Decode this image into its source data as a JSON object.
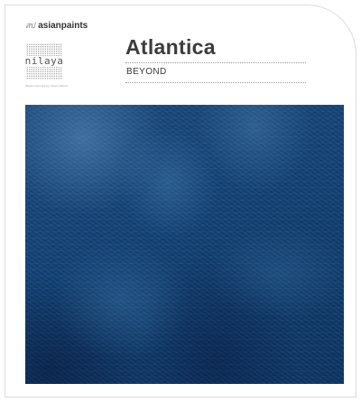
{
  "brand": {
    "mark": "สป",
    "name": "asianpaints"
  },
  "nilaya": {
    "word": "nilaya",
    "caption": "Wallcoverings by Asian Paints"
  },
  "product": {
    "title": "Atlantica",
    "subtitle": "BEYOND"
  },
  "swatch": {
    "color": "#123a66"
  }
}
